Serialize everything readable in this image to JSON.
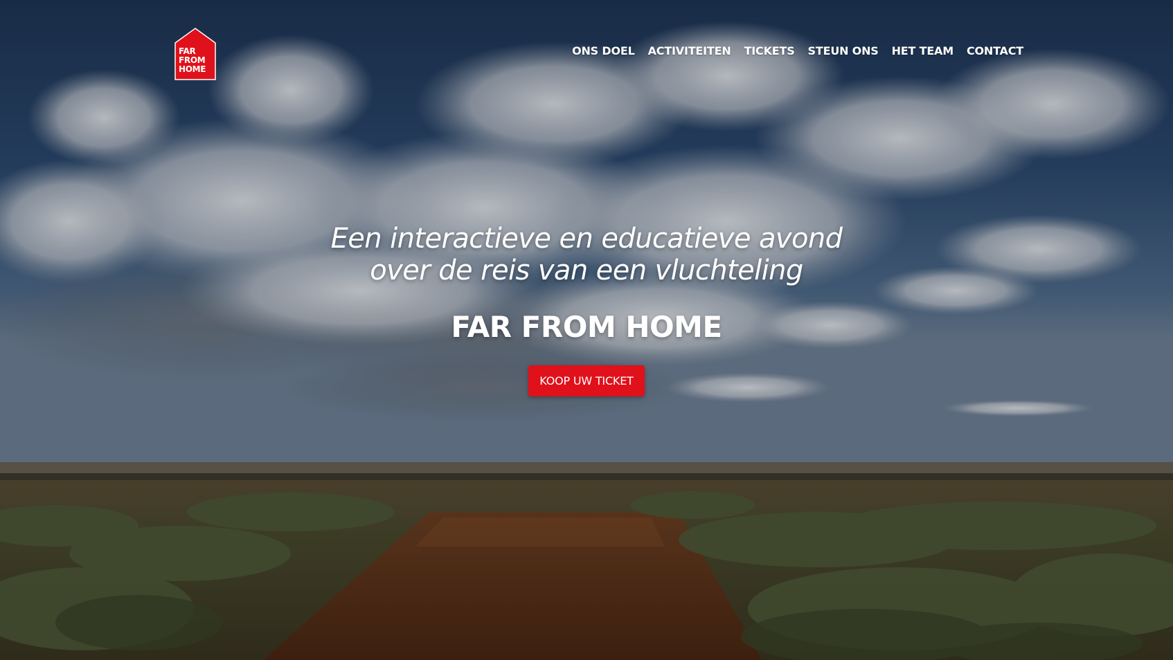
{
  "brand": {
    "logo_lines": [
      "FAR",
      "FROM",
      "HOME"
    ],
    "logo_color": "#e0111b"
  },
  "nav": {
    "items": [
      {
        "label": "ONS DOEL"
      },
      {
        "label": "ACTIVITEITEN"
      },
      {
        "label": "TICKETS"
      },
      {
        "label": "STEUN ONS"
      },
      {
        "label": "HET TEAM"
      },
      {
        "label": "CONTACT"
      }
    ]
  },
  "hero": {
    "tagline_line1": "Een interactieve en educatieve avond",
    "tagline_line2": "over de reis van een vluchteling",
    "title": "FAR FROM HOME",
    "cta_label": "KOOP UW TICKET",
    "cta_color": "#e0111b"
  }
}
